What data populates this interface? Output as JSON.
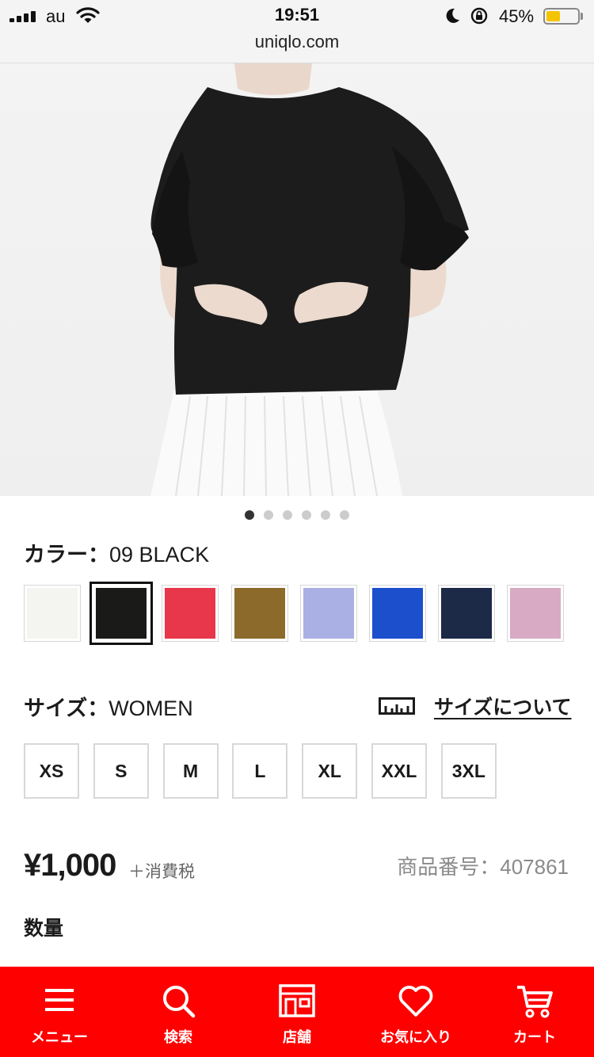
{
  "status_bar": {
    "carrier": "au",
    "time": "19:51",
    "url": "uniqlo.com",
    "battery_percent": "45%",
    "battery_level": 0.45,
    "icons": [
      "signal-icon",
      "wifi-icon",
      "moon-icon",
      "orientation-lock-icon",
      "battery-icon"
    ]
  },
  "product_image": {
    "carousel_count": 6,
    "active_index": 0
  },
  "color": {
    "label": "カラー：",
    "value": "09 BLACK",
    "selected_index": 1,
    "swatches": [
      {
        "name": "white",
        "hex": "#f4f4f0"
      },
      {
        "name": "black",
        "hex": "#1a1a18"
      },
      {
        "name": "red",
        "hex": "#e8364a"
      },
      {
        "name": "olive-brown",
        "hex": "#8c6a2c"
      },
      {
        "name": "lavender",
        "hex": "#aab0e3"
      },
      {
        "name": "blue",
        "hex": "#1b4fcc"
      },
      {
        "name": "navy",
        "hex": "#1c2a48"
      },
      {
        "name": "pink",
        "hex": "#d9aac4"
      }
    ]
  },
  "size": {
    "label": "サイズ：",
    "value": "WOMEN",
    "guide_link": "サイズについて",
    "options": [
      "XS",
      "S",
      "M",
      "L",
      "XL",
      "XXL",
      "3XL"
    ]
  },
  "price": {
    "amount": "¥1,000",
    "tax_note": "＋消費税",
    "product_code": "商品番号：407861"
  },
  "quantity_label": "数量",
  "bottom_nav": [
    {
      "label": "メニュー",
      "icon": "menu-icon"
    },
    {
      "label": "検索",
      "icon": "search-icon"
    },
    {
      "label": "店舗",
      "icon": "store-icon"
    },
    {
      "label": "お気に入り",
      "icon": "heart-icon"
    },
    {
      "label": "カート",
      "icon": "cart-icon"
    }
  ],
  "colors": {
    "brand_red": "#ff0000",
    "text": "#1b1b1b",
    "muted": "#8a8a8a"
  }
}
